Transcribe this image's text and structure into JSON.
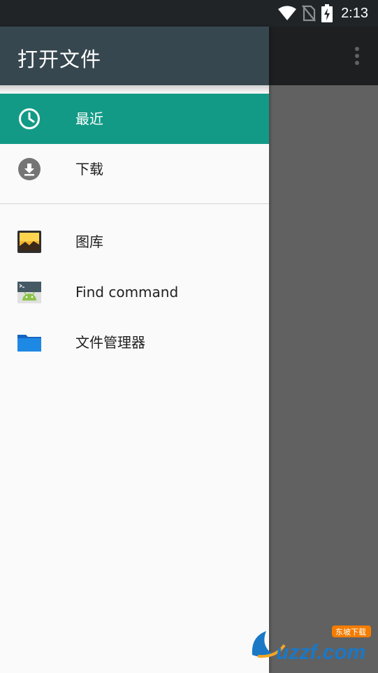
{
  "status_bar": {
    "time": "2:13"
  },
  "drawer": {
    "title": "打开文件",
    "items": [
      {
        "label": "最近",
        "icon": "clock-icon",
        "active": true
      },
      {
        "label": "下载",
        "icon": "download-icon",
        "active": false
      }
    ],
    "apps": [
      {
        "label": "图库",
        "icon": "gallery-icon"
      },
      {
        "label": "Find command",
        "icon": "android-terminal-icon"
      },
      {
        "label": "文件管理器",
        "icon": "folder-icon"
      }
    ]
  },
  "watermark": {
    "text": "uzzf.com",
    "tag": "东坡下载"
  },
  "colors": {
    "drawer_header": "#37474f",
    "active_item": "#139a86",
    "scrim": "#616161",
    "status_bar": "#202427"
  }
}
